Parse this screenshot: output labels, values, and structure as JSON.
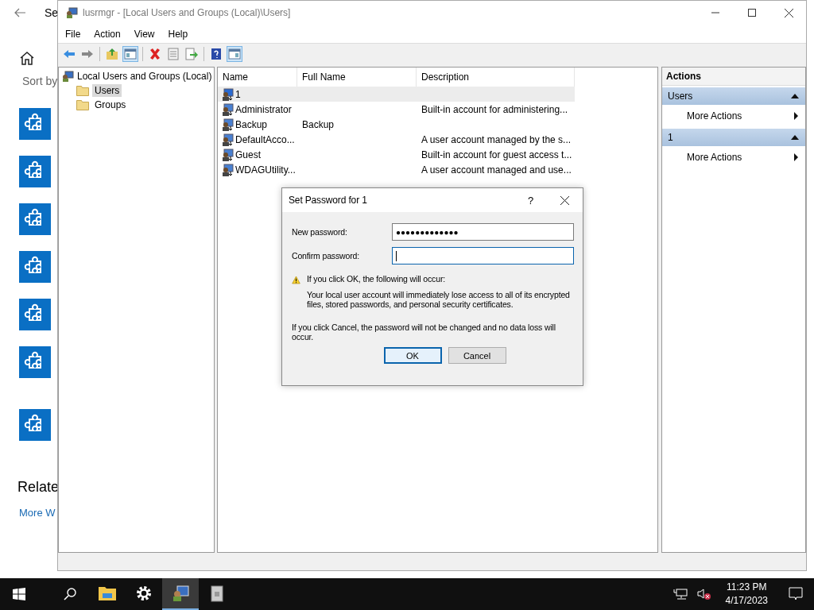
{
  "background": {
    "header": "Se",
    "sort_label": "Sort by",
    "related_heading": "Relate",
    "related_link": "More W"
  },
  "window": {
    "title": "lusrmgr - [Local Users and Groups (Local)\\Users]",
    "menu": [
      "File",
      "Action",
      "View",
      "Help"
    ],
    "toolbar": [
      [
        {
          "kind": "back",
          "pressed": false
        },
        {
          "kind": "forward",
          "pressed": false
        }
      ],
      [
        {
          "kind": "up",
          "pressed": false
        },
        {
          "kind": "tree",
          "pressed": true
        }
      ],
      [
        {
          "kind": "delete",
          "pressed": false
        },
        {
          "kind": "properties",
          "pressed": false
        },
        {
          "kind": "export",
          "pressed": false
        }
      ],
      [
        {
          "kind": "help",
          "pressed": false
        },
        {
          "kind": "pane",
          "pressed": true
        }
      ]
    ]
  },
  "tree": {
    "label": "Local Users and Groups (Local)",
    "children": [
      {
        "label": "Users",
        "selected": true
      },
      {
        "label": "Groups",
        "selected": false
      }
    ]
  },
  "table": {
    "columns": [
      "Name",
      "Full Name",
      "Description"
    ],
    "rows": [
      {
        "name": "1",
        "selected": true
      },
      {
        "name": "Administrator",
        "description": "Built-in account for administering...",
        "selected": false
      },
      {
        "name": "Backup",
        "full_name": "Backup",
        "selected": false
      },
      {
        "name": "DefaultAcco...",
        "description": "A user account managed by the s...",
        "selected": false
      },
      {
        "name": "Guest",
        "description": "Built-in account for guest access t...",
        "selected": false
      },
      {
        "name": "WDAGUtility...",
        "description": "A user account managed and use...",
        "selected": false
      }
    ]
  },
  "actions": {
    "title": "Actions",
    "sections": [
      {
        "title": "Users",
        "items": [
          "More Actions"
        ]
      },
      {
        "title": "1",
        "items": [
          "More Actions"
        ]
      }
    ]
  },
  "dialog": {
    "title": "Set Password for 1",
    "help": "?",
    "fields": [
      {
        "label": "New password:",
        "value": "●●●●●●●●●●●●●",
        "focused": false
      },
      {
        "label": "Confirm password:",
        "focused": true
      }
    ],
    "warning_heading": "If you click OK, the following will occur:",
    "warning_body": "Your local user account will immediately lose access to all of its encrypted files, stored passwords, and personal security certificates.",
    "cancel_note": "If you click Cancel, the password will not be changed and no data loss will occur.",
    "buttons": [
      {
        "label": "OK",
        "default": true
      },
      {
        "label": "Cancel",
        "default": false
      }
    ]
  },
  "taskbar": {
    "apps": [
      {
        "kind": "explorer",
        "active": false
      },
      {
        "kind": "settings",
        "active": false
      },
      {
        "kind": "users",
        "active": true
      },
      {
        "kind": "archive",
        "active": false
      }
    ],
    "time": "11:23 PM",
    "date": "4/17/2023"
  }
}
